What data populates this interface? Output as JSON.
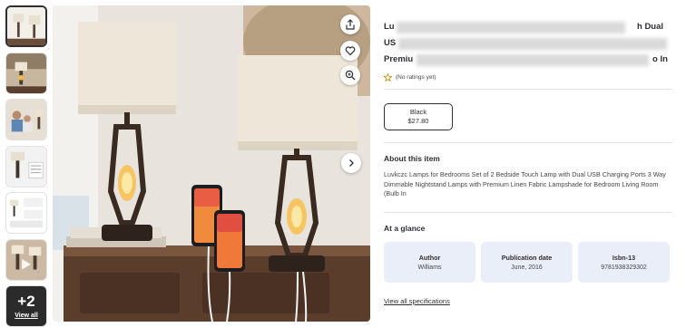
{
  "gallery": {
    "more_count": "+2",
    "view_all_label": "View all"
  },
  "product": {
    "title_lines": [
      "Lu",
      "h Dual",
      "US",
      "Premiu",
      "o In"
    ]
  },
  "rating": {
    "text": "(No ratings yet)"
  },
  "variant": {
    "name": "Black",
    "price": "$27.80"
  },
  "about": {
    "heading": "About this item",
    "description": "Luvkczc Lamps for Bedrooms Set of 2 Bedside Touch Lamp with Dual USB Charging Ports 3 Way Dimmable Nightstand Lamps with Premium Linen Fabric Lampshade for Bedroom Living Room (Bulb In"
  },
  "glance": {
    "heading": "At a glance",
    "cards": [
      {
        "label": "Author",
        "value": "Williams"
      },
      {
        "label": "Publication date",
        "value": "June, 2016"
      },
      {
        "label": "Isbn-13",
        "value": "9781938329302"
      }
    ],
    "view_all_link": "View all specifications"
  },
  "icons": {
    "share": "share-icon",
    "favorite": "heart-icon",
    "zoom": "zoom-in-icon",
    "next": "chevron-right-icon",
    "star": "star-outline-icon"
  }
}
